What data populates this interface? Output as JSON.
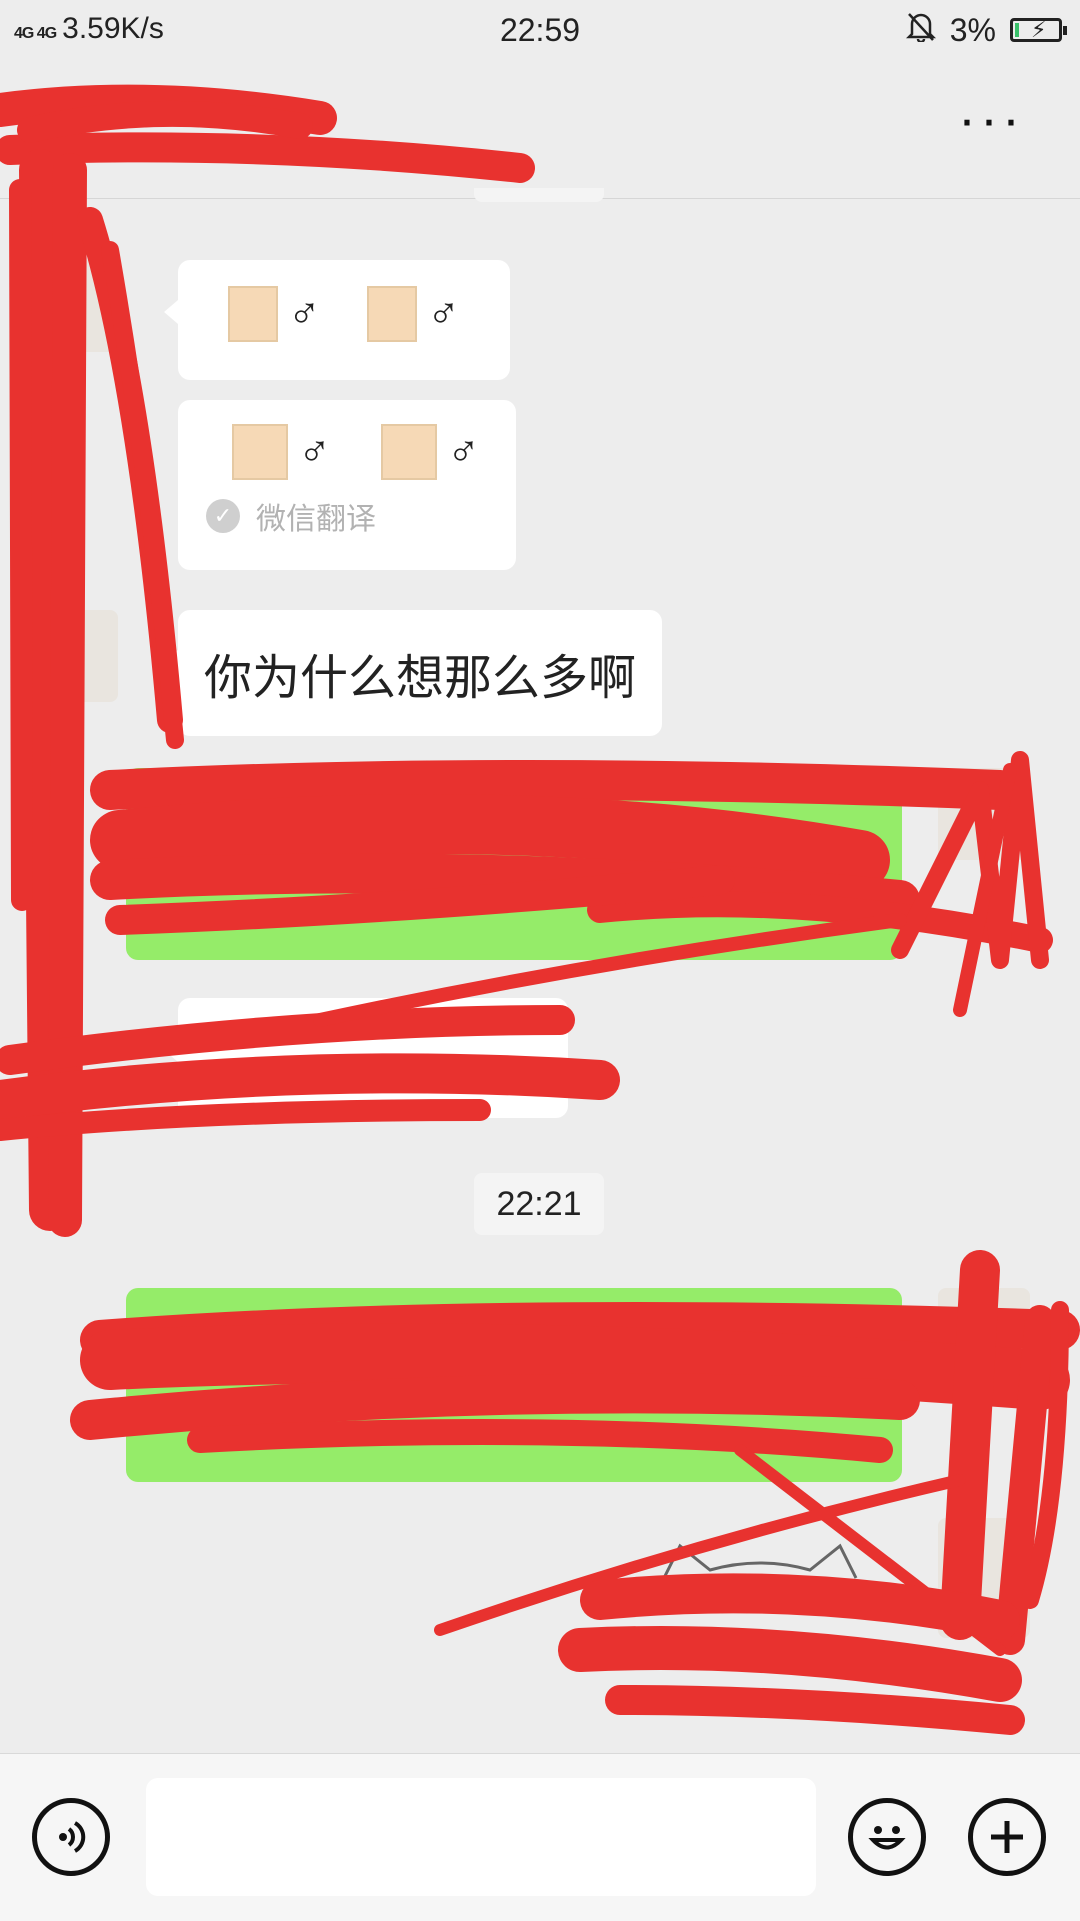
{
  "status_bar": {
    "network": "4G 4G",
    "speed": "3.59K/s",
    "time": "22:59",
    "battery": "3%",
    "icons": [
      "signal-icon",
      "mute-bell-icon",
      "battery-charging-icon"
    ]
  },
  "header": {
    "title": "",
    "more": "···"
  },
  "messages": {
    "emoji_1": "♂",
    "emoji_2": "♂",
    "emoji_3": "♂",
    "emoji_4": "♂",
    "translate_label": "微信翻译",
    "text_message": "你为什么想那么多啊",
    "timestamp": "22:21"
  },
  "input_bar": {
    "placeholder": "",
    "icons": [
      "voice-icon",
      "emoji-icon",
      "plus-icon"
    ]
  },
  "colors": {
    "background": "#ededed",
    "bubble_white": "#ffffff",
    "bubble_green": "#95ec69",
    "redaction": "#e8322f"
  }
}
